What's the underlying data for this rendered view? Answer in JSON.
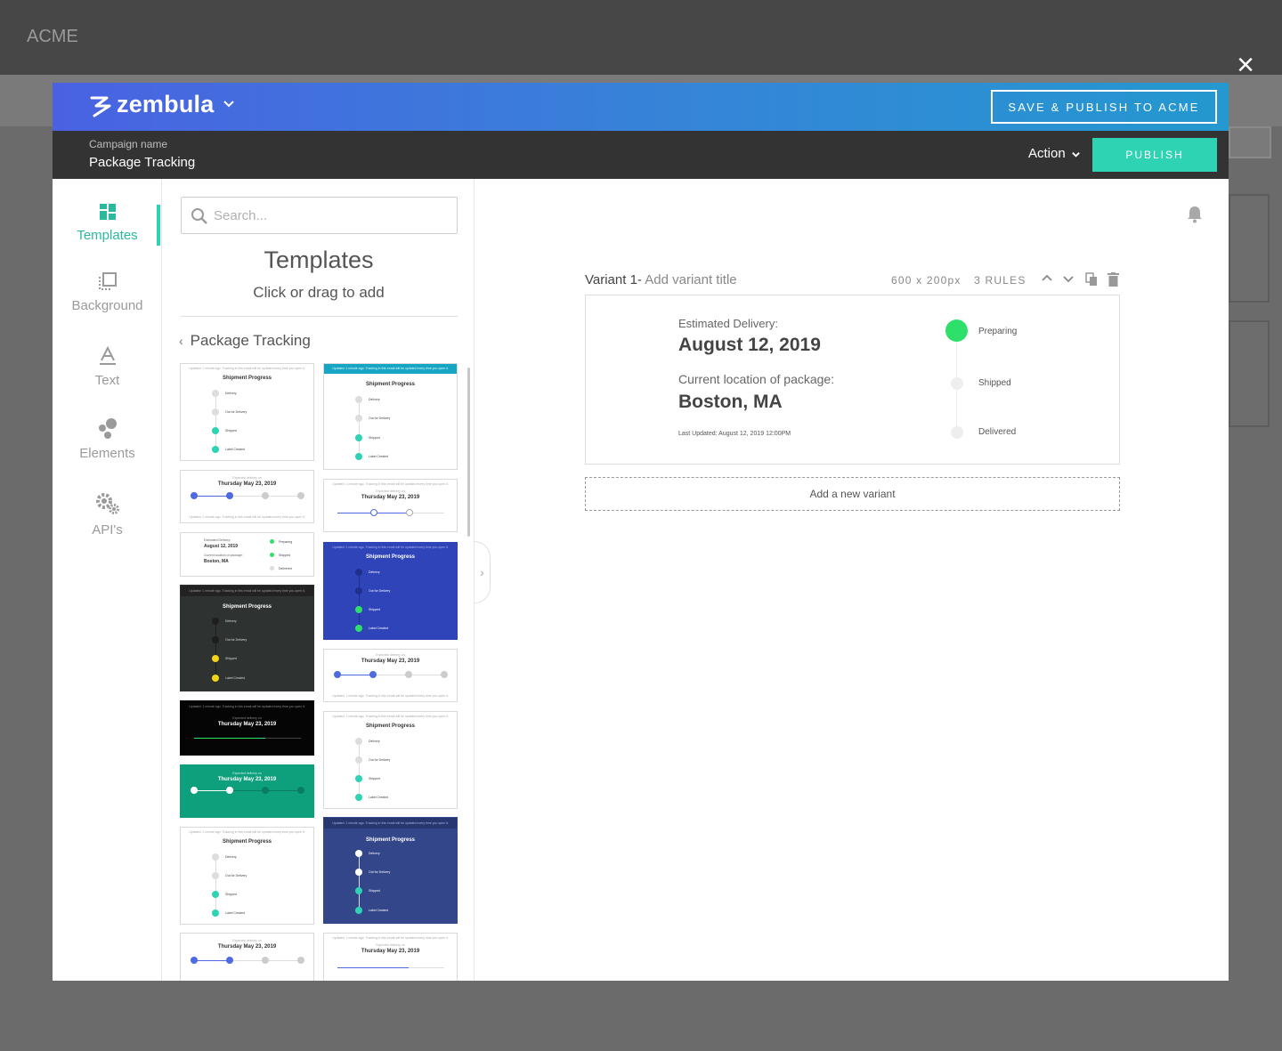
{
  "background": {
    "app_name": "ACME",
    "close_label": "×"
  },
  "header": {
    "logo": "zembula",
    "save_publish": "SAVE & PUBLISH TO ACME"
  },
  "campaign": {
    "label": "Campaign name",
    "name": "Package Tracking",
    "action": "Action",
    "publish": "PUBLISH"
  },
  "nav": {
    "items": [
      {
        "label": "Templates",
        "icon": "templates-icon",
        "active": true
      },
      {
        "label": "Background",
        "icon": "background-icon"
      },
      {
        "label": "Text",
        "icon": "text-icon"
      },
      {
        "label": "Elements",
        "icon": "elements-icon"
      },
      {
        "label": "API's",
        "icon": "gears-icon"
      }
    ]
  },
  "panel": {
    "search_placeholder": "Search...",
    "title": "Templates",
    "subtitle": "Click or drag to add",
    "breadcrumb": "Package Tracking"
  },
  "thumb_text": {
    "shipment_progress": "Shipment Progress",
    "delivery": "Delivery",
    "out_for_delivery": "Out for Delivery",
    "shipped": "Shipped",
    "label_created": "Label Created",
    "expected": "Expected delivery on",
    "date": "Thursday May 23, 2019",
    "updated": "Updated: 1 minute ago. Tracking in this email will be updated every time you open it.",
    "est": "Estimated Delivery:",
    "est_date": "August 12, 2019",
    "loc": "Current location of package:",
    "loc_val": "Boston, MA",
    "preparing": "Preparing",
    "delivered": "Delivered"
  },
  "variant": {
    "label": "Variant 1-",
    "title_placeholder": "Add variant title",
    "size": "600 x 200px",
    "rules": "3 RULES",
    "add_new": "Add a new variant"
  },
  "preview": {
    "est_label": "Estimated Delivery:",
    "est_date": "August 12, 2019",
    "loc_label": "Current location of package:",
    "loc_value": "Boston, MA",
    "updated": "Last Updated: August 12, 2019 12:00PM",
    "steps": [
      {
        "label": "Preparing",
        "active": true
      },
      {
        "label": "Shipped",
        "active": false
      },
      {
        "label": "Delivered",
        "active": false
      }
    ]
  },
  "colors": {
    "accent": "#2ed3b4",
    "header_start": "#4a62e2",
    "header_end": "#2498cf",
    "active_step": "#2ee06a"
  }
}
